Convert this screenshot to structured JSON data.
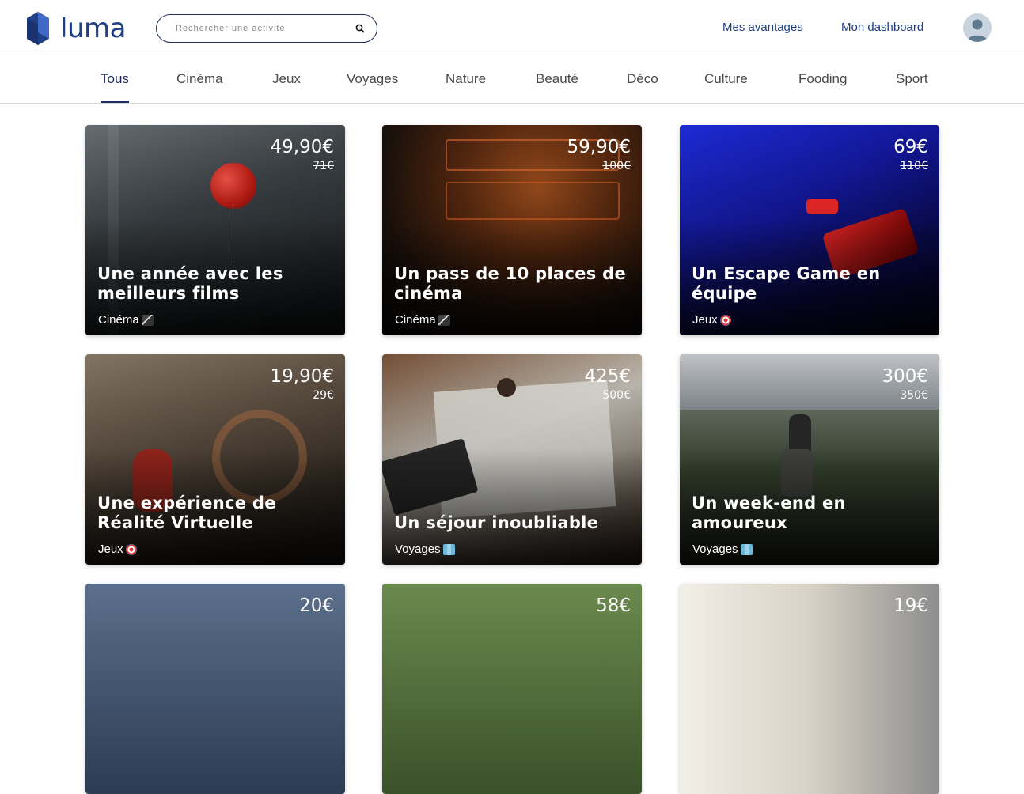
{
  "header": {
    "logo_text": "luma",
    "search_placeholder": "Rechercher une activité",
    "nav": {
      "avantages": "Mes avantages",
      "dashboard": "Mon dashboard"
    }
  },
  "categories": [
    "Tous",
    "Cinéma",
    "Jeux",
    "Voyages",
    "Nature",
    "Beauté",
    "Déco",
    "Culture",
    "Fooding",
    "Sport"
  ],
  "active_category": "Tous",
  "cards": [
    {
      "title": "Une année avec les meilleurs films",
      "category": "Cinéma",
      "icon": "clapperboard-icon",
      "price": "49,90€",
      "old_price": "71€"
    },
    {
      "title": "Un pass de 10 places de cinéma",
      "category": "Cinéma",
      "icon": "clapperboard-icon",
      "price": "59,90€",
      "old_price": "100€"
    },
    {
      "title": "Un Escape Game en équipe",
      "category": "Jeux",
      "icon": "dart-target-icon",
      "price": "69€",
      "old_price": "110€"
    },
    {
      "title": "Une expérience de Réalité Virtuelle",
      "category": "Jeux",
      "icon": "dart-target-icon",
      "price": "19,90€",
      "old_price": "29€"
    },
    {
      "title": "Un séjour inoubliable",
      "category": "Voyages",
      "icon": "map-icon",
      "price": "425€",
      "old_price": "500€"
    },
    {
      "title": "Un week-end en amoureux",
      "category": "Voyages",
      "icon": "map-icon",
      "price": "300€",
      "old_price": "350€"
    },
    {
      "price": "20€"
    },
    {
      "price": "58€"
    },
    {
      "price": "19€"
    }
  ],
  "colors": {
    "brand": "#1f3f86",
    "text_dark": "#1f2d5c"
  }
}
